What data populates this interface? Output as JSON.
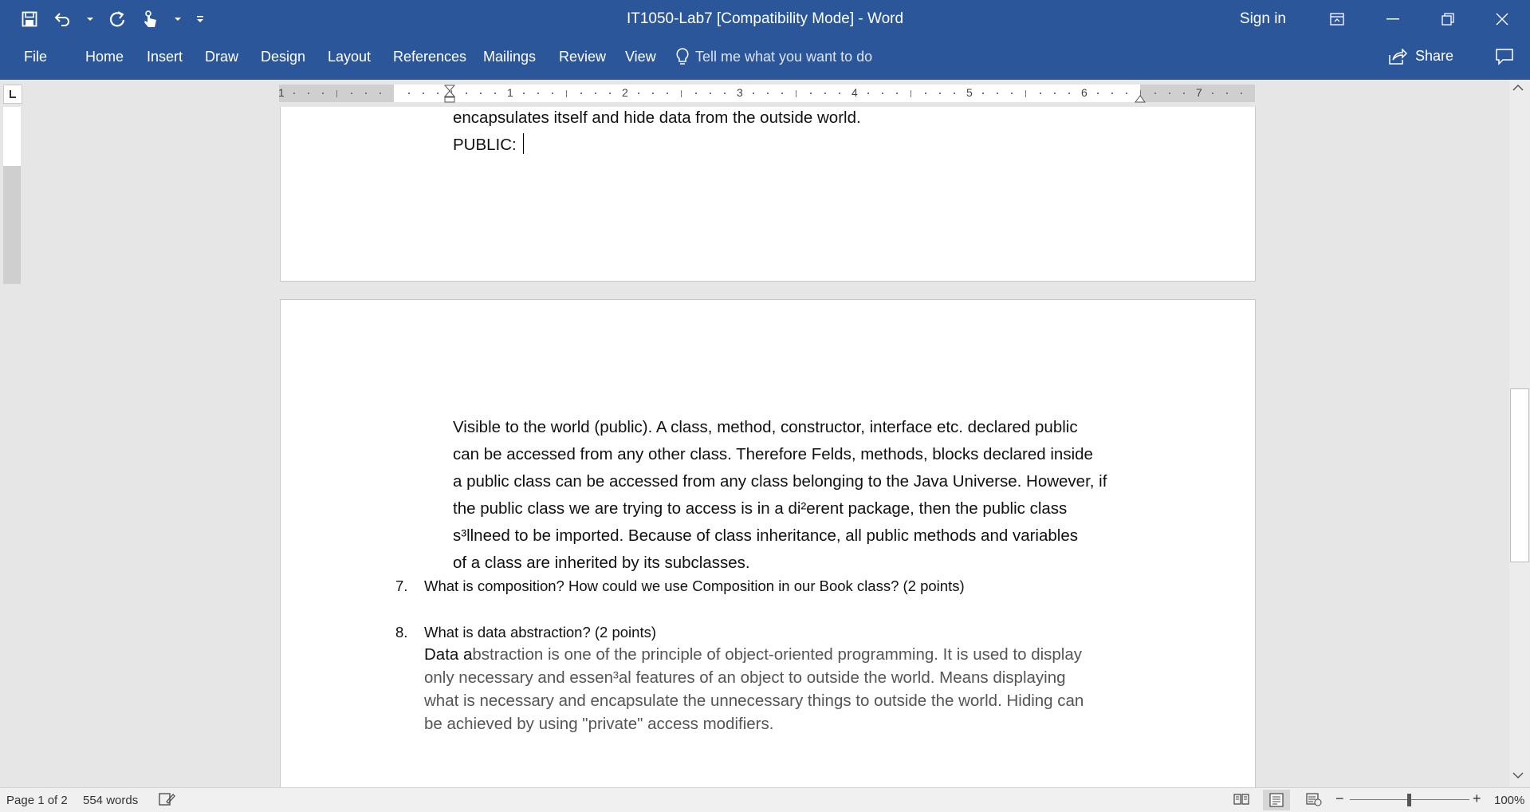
{
  "window": {
    "title": "IT1050-Lab7 [Compatibility Mode]  -  Word",
    "sign_in": "Sign in"
  },
  "ribbon": {
    "tabs": [
      "File",
      "Home",
      "Insert",
      "Draw",
      "Design",
      "Layout",
      "References",
      "Mailings",
      "Review",
      "View"
    ],
    "tell_me_placeholder": "Tell me what you want to do",
    "share": "Share"
  },
  "ruler": {
    "numbers": [
      "1",
      "1",
      "2",
      "3",
      "4",
      "5",
      "6",
      "7"
    ]
  },
  "document": {
    "page1_line1": "encapsulates itself and hide data from the outside world.",
    "page1_line2": "PUBLIC:",
    "page2_paragraph": [
      "Visible to the world (public). A class, method, constructor, interface etc. declared public",
      "can be accessed from any other class. Therefore Felds, methods, blocks declared inside",
      "a public class can be accessed from any class belonging to the Java Universe. However, if",
      "the public class we are trying to access is in a di²erent package, then the public class",
      "s³llneed to be imported. Because of class inheritance, all public methods and variables",
      "of a class are inherited by its subclasses."
    ],
    "q7_num": "7.",
    "q7_text": "What is composition?  How could we use Composition in our Book class? (2 points)",
    "q8_num": "8.",
    "q8_text": "What is data abstraction? (2 points)",
    "q8_answer_first": "Data a",
    "q8_answer_rest": [
      "bstraction is one of the principle of object-oriented programming. It is used to display",
      "only necessary and essen³al features of an object to outside the world. Means displaying",
      "what is necessary and encapsulate the unnecessary things to outside the world. Hiding can",
      "be achieved by using \"private\" access modifiers."
    ]
  },
  "status_bar": {
    "page": "Page 1 of 2",
    "words": "554 words",
    "zoom": "100%"
  }
}
